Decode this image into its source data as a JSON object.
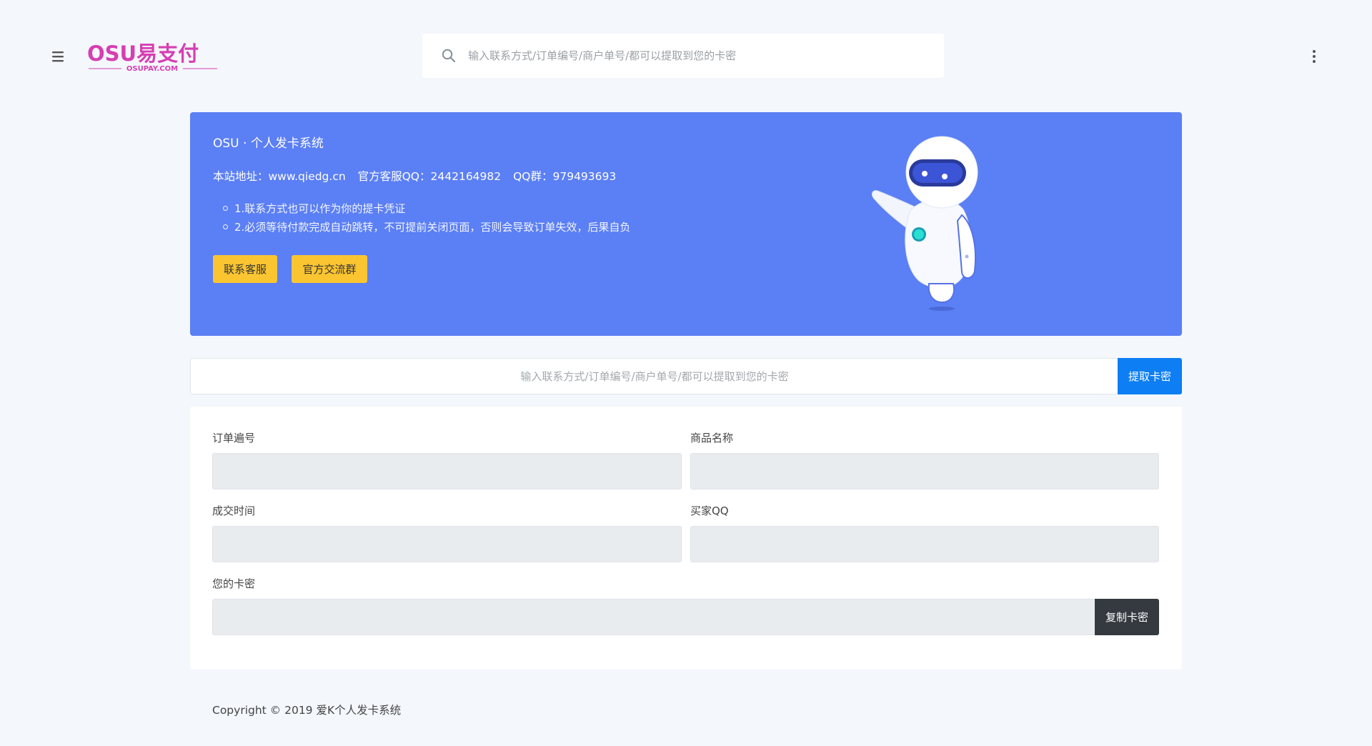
{
  "header": {
    "logo": {
      "main_text": "OSU易支付",
      "sub_text": "OSUPAY.COM",
      "color": "#d63fb2"
    },
    "search": {
      "placeholder": "输入联系方式/订单编号/商户单号/都可以提取到您的卡密",
      "icon": "search-icon"
    },
    "menu_icon": "hamburger-menu-icon",
    "more_icon": "more-vertical-icon"
  },
  "hero": {
    "title": "OSU · 个人发卡系统",
    "site_address": "本站地址：www.qiedg.cn",
    "service_qq": "官方客服QQ：2442164982",
    "qq_group": "QQ群：979493693",
    "notes": [
      "1.联系方式也可以作为你的提卡凭证",
      "2.必须等待付款完成自动跳转，不可提前关闭页面，否则会导致订单失效，后果自负"
    ],
    "contact_button": "联系客服",
    "group_button": "官方交流群",
    "background_color": "#5b7ff4",
    "button_color": "#fbc531"
  },
  "extract": {
    "placeholder": "输入联系方式/订单编号/商户单号/都可以提取到您的卡密",
    "button": "提取卡密",
    "button_color": "#0d7ef3"
  },
  "order": {
    "order_no_label": "订单遍号",
    "product_name_label": "商品名称",
    "trade_time_label": "成交时间",
    "buyer_qq_label": "买家QQ",
    "card_secret_label": "您的卡密",
    "order_no_value": "",
    "product_name_value": "",
    "trade_time_value": "",
    "buyer_qq_value": "",
    "card_secret_value": "",
    "copy_button": "复制卡密",
    "copy_button_color": "#343a40"
  },
  "footer": {
    "copyright": "Copyright © 2019 爱K个人发卡系统"
  }
}
